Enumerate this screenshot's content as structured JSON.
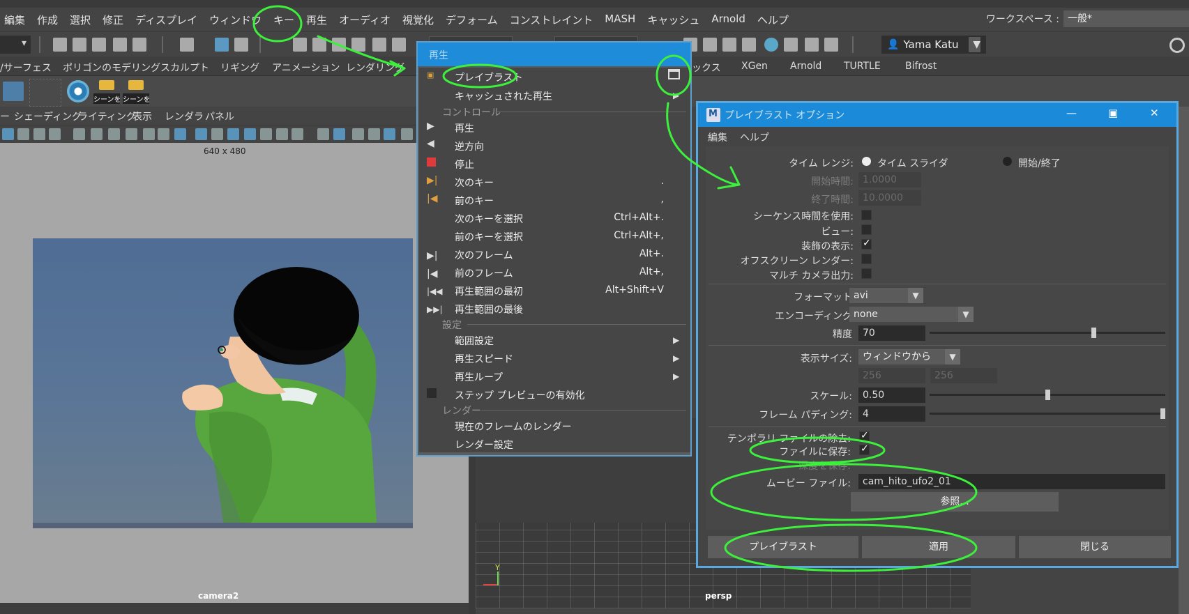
{
  "menubar": {
    "items": [
      "編集",
      "作成",
      "選択",
      "修正",
      "ディスプレイ",
      "ウィンドウ",
      "キー",
      "再生",
      "オーディオ",
      "視覚化",
      "デフォーム",
      "コンストレイント",
      "MASH",
      "キャッシュ",
      "Arnold",
      "ヘルプ"
    ],
    "workspace_label": "ワークスペース :",
    "workspace_value": "一般*"
  },
  "toolbar": {
    "user_name": "Yama Katu"
  },
  "shelf_tabs": [
    "/サーフェス",
    "ポリゴンのモデリング",
    "スカルプト",
    "リギング",
    "アニメーション",
    "レンダリング",
    "ックス",
    "XGen",
    "Arnold",
    "TURTLE",
    "Bifrost"
  ],
  "shelf": {
    "btn1_caption": "シーンを",
    "btn2_caption": "シーンを"
  },
  "viewport_left": {
    "menu": [
      "ー",
      "シェーディング",
      "ライティング",
      "表示",
      "レンダラ",
      "パネル"
    ],
    "resolution": "640 x 480",
    "camera": "camera2"
  },
  "viewport_right": {
    "camera": "persp",
    "axis_y": "Y"
  },
  "playback_menu": {
    "title": "再生",
    "playblast": "プレイブラスト",
    "cached_playback": "キャッシュされた再生",
    "sections": {
      "control": "コントロール",
      "settings": "設定",
      "render": "レンダー"
    },
    "items": [
      {
        "label": "再生",
        "shortcut": ""
      },
      {
        "label": "逆方向",
        "shortcut": ""
      },
      {
        "label": "停止",
        "shortcut": ""
      },
      {
        "label": "次のキー",
        "shortcut": "."
      },
      {
        "label": "前のキー",
        "shortcut": ","
      },
      {
        "label": "次のキーを選択",
        "shortcut": "Ctrl+Alt+."
      },
      {
        "label": "前のキーを選択",
        "shortcut": "Ctrl+Alt+,"
      },
      {
        "label": "次のフレーム",
        "shortcut": "Alt+."
      },
      {
        "label": "前のフレーム",
        "shortcut": "Alt+,"
      },
      {
        "label": "再生範囲の最初",
        "shortcut": "Alt+Shift+V"
      },
      {
        "label": "再生範囲の最後",
        "shortcut": ""
      }
    ],
    "settings_items": [
      "範囲設定",
      "再生スピード",
      "再生ループ",
      "ステップ プレビューの有効化"
    ],
    "render_items": [
      "現在のフレームのレンダー",
      "レンダー設定"
    ]
  },
  "options_dialog": {
    "title": "プレイブラスト オプション",
    "menu": [
      "編集",
      "ヘルプ"
    ],
    "time_range_label": "タイム レンジ:",
    "time_slider": "タイム スライダ",
    "start_end": "開始/終了",
    "start_time_label": "開始時間:",
    "start_time": "1.0000",
    "end_time_label": "終了時間:",
    "end_time": "10.0000",
    "use_sequence_time": "シーケンス時間を使用:",
    "view": "ビュー:",
    "show_ornaments": "装飾の表示:",
    "offscreen": "オフスクリーン レンダー:",
    "multi_camera": "マルチ カメラ出力:",
    "format_label": "フォーマット",
    "format": "avi",
    "encoding_label": "エンコーディング",
    "encoding": "none",
    "quality_label": "精度",
    "quality": "70",
    "quality_fraction": 0.7,
    "display_size_label": "表示サイズ:",
    "display_size": "ウィンドウから",
    "width": "256",
    "height": "256",
    "scale_label": "スケール:",
    "scale": "0.50",
    "scale_fraction": 0.5,
    "padding_label": "フレーム パディング:",
    "padding": "4",
    "padding_fraction": 1.0,
    "remove_temp": "テンポラリ ファイルの除去:",
    "save_to_file": "ファイルに保存:",
    "save_depth": "深度を保存:",
    "movie_file_label": "ムービー ファイル:",
    "movie_file": "cam_hito_ufo2_01",
    "browse": "参照...",
    "buttons": {
      "playblast": "プレイブラスト",
      "apply": "適用",
      "close": "閉じる"
    }
  }
}
